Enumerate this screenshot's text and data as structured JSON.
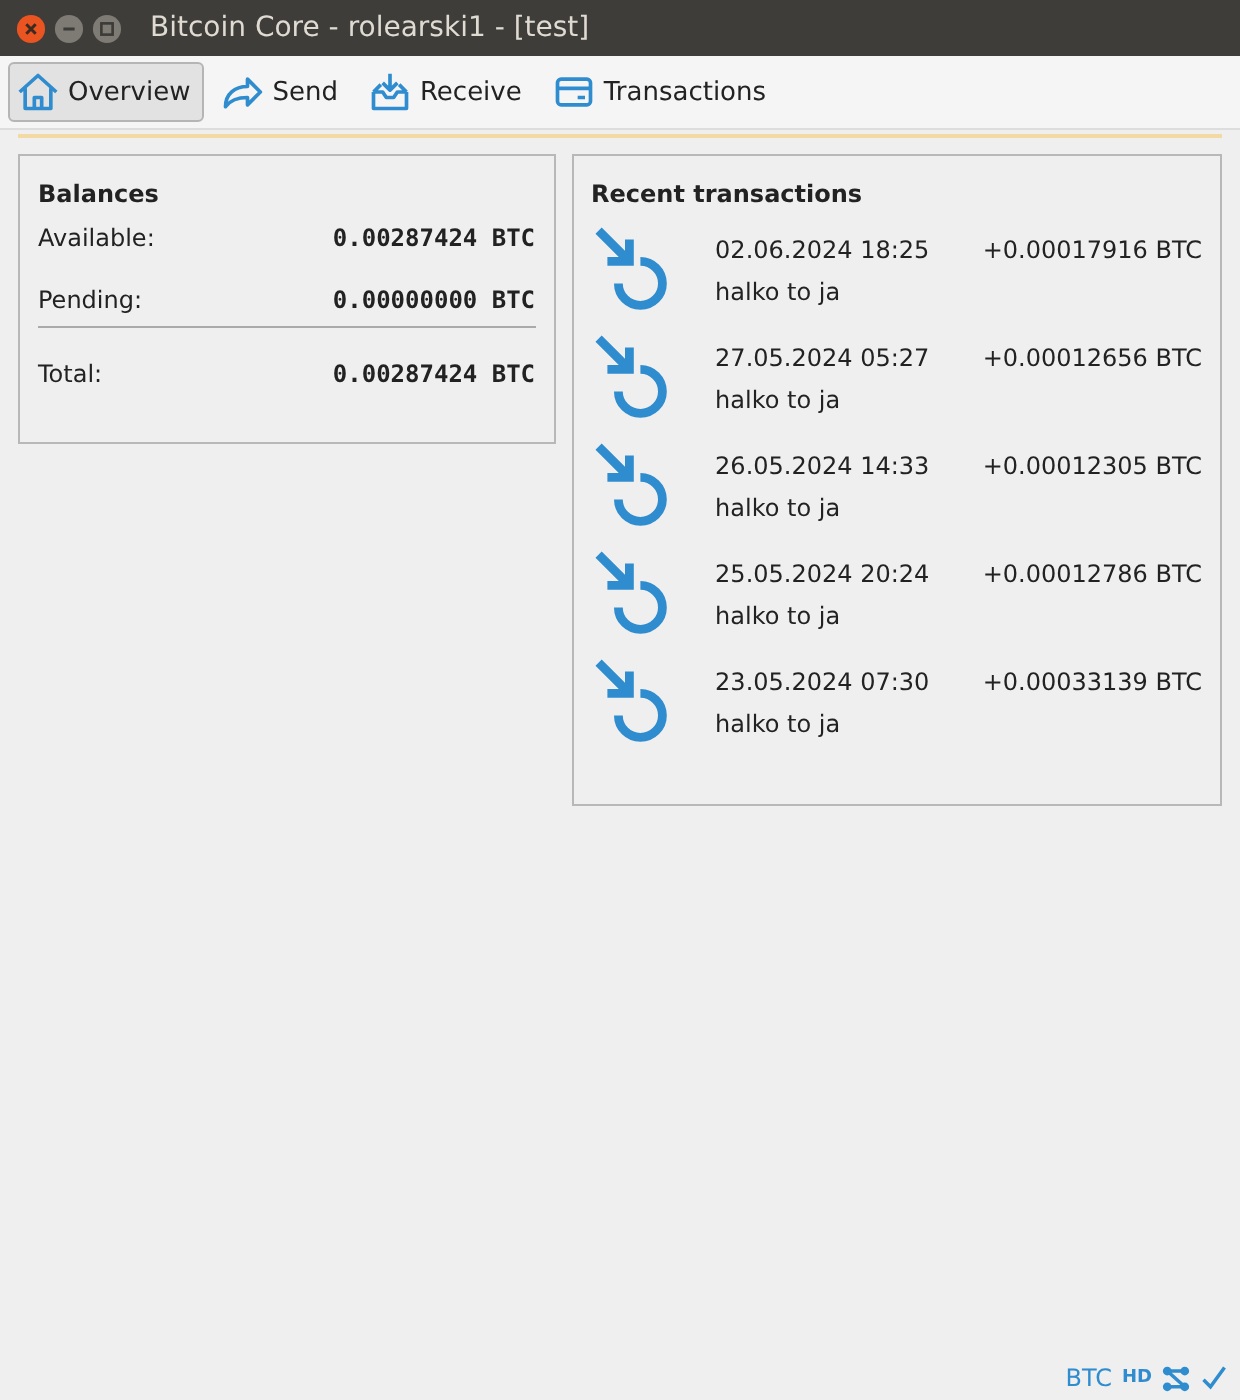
{
  "window": {
    "title": "Bitcoin Core - rolearski1 - [test]"
  },
  "tabs": [
    {
      "label": "Overview",
      "selected": true,
      "kind": "home"
    },
    {
      "label": "Send",
      "selected": false,
      "kind": "send"
    },
    {
      "label": "Receive",
      "selected": false,
      "kind": "receive"
    },
    {
      "label": "Transactions",
      "selected": false,
      "kind": "transactions"
    }
  ],
  "balances": {
    "title": "Balances",
    "rows": [
      {
        "label": "Available:",
        "value": "0.00287424 BTC"
      },
      {
        "label": "Pending:",
        "value": "0.00000000 BTC"
      },
      {
        "label": "Total:",
        "value": "0.00287424 BTC"
      }
    ]
  },
  "recent": {
    "title": "Recent transactions",
    "items": [
      {
        "date": "02.06.2024 18:25",
        "amount": "+0.00017916 BTC",
        "label": "halko to ja"
      },
      {
        "date": "27.05.2024 05:27",
        "amount": "+0.00012656 BTC",
        "label": "halko to ja"
      },
      {
        "date": "26.05.2024 14:33",
        "amount": "+0.00012305 BTC",
        "label": "halko to ja"
      },
      {
        "date": "25.05.2024 20:24",
        "amount": "+0.00012786 BTC",
        "label": "halko to ja"
      },
      {
        "date": "23.05.2024 07:30",
        "amount": "+0.00033139 BTC",
        "label": "halko to ja"
      }
    ]
  },
  "status_bar": {
    "unit": "BTC",
    "hd": "HD"
  }
}
